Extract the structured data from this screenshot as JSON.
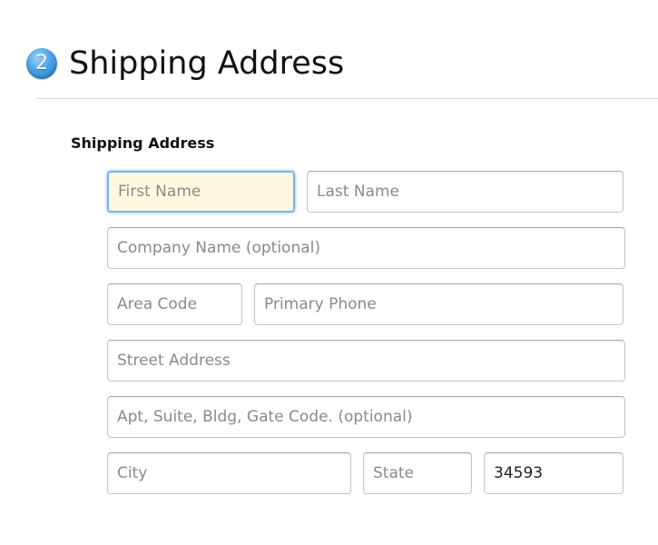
{
  "section": {
    "step_number": "2",
    "title": "Shipping Address"
  },
  "form": {
    "label": "Shipping Address",
    "fields": {
      "first_name": {
        "placeholder": "First Name",
        "value": ""
      },
      "last_name": {
        "placeholder": "Last Name",
        "value": ""
      },
      "company_name": {
        "placeholder": "Company Name (optional)",
        "value": ""
      },
      "area_code": {
        "placeholder": "Area Code",
        "value": ""
      },
      "primary_phone": {
        "placeholder": "Primary Phone",
        "value": ""
      },
      "street_address": {
        "placeholder": "Street Address",
        "value": ""
      },
      "apt_suite": {
        "placeholder": "Apt, Suite, Bldg, Gate Code. (optional)",
        "value": ""
      },
      "city": {
        "placeholder": "City",
        "value": ""
      },
      "state": {
        "placeholder": "State",
        "value": ""
      },
      "zip": {
        "placeholder": "",
        "value": "34593"
      }
    },
    "focused_field": "first_name"
  },
  "colors": {
    "focus_border": "#78b4ee",
    "focus_background": "#fff8e1",
    "badge": "#4aa3e6"
  }
}
